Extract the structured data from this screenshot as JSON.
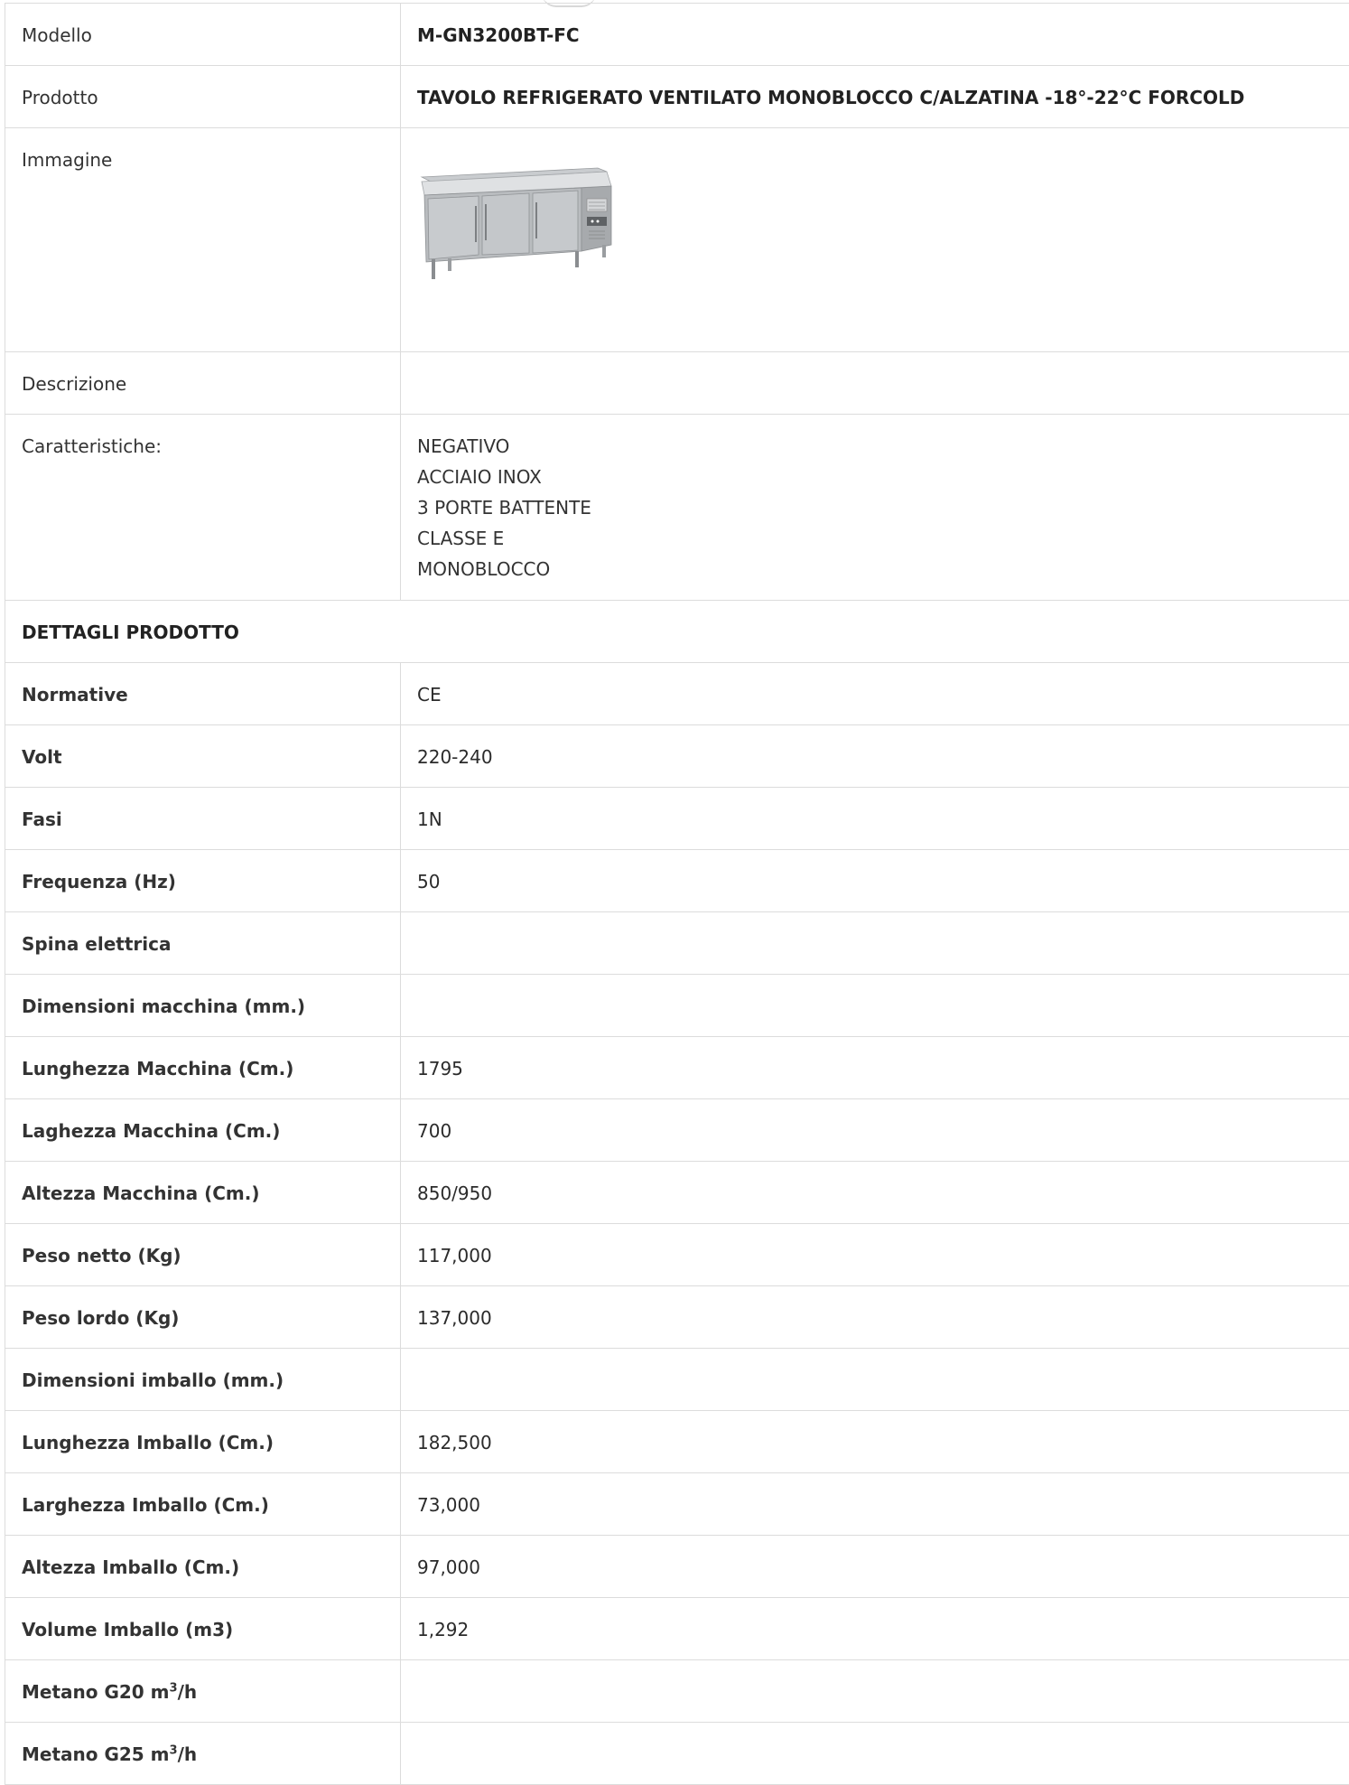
{
  "header_rows": [
    {
      "label": "Modello",
      "value": "M-GN3200BT-FC"
    },
    {
      "label": "Prodotto",
      "value": "TAVOLO REFRIGERATO VENTILATO MONOBLOCCO C/ALZATINA -18°-22°C FORCOLD"
    }
  ],
  "image_row": {
    "label": "Immagine",
    "image_icon": "refrigerated-table-image"
  },
  "description_row": {
    "label": "Descrizione",
    "value": ""
  },
  "features_row": {
    "label": "Caratteristiche:",
    "items": [
      "NEGATIVO",
      "ACCIAIO INOX",
      "3 PORTE BATTENTE",
      "CLASSE E",
      "MONOBLOCCO"
    ]
  },
  "section_title": "DETTAGLI PRODOTTO",
  "details": [
    {
      "label": "Normative",
      "value": "CE"
    },
    {
      "label": "Volt",
      "value": "220-240"
    },
    {
      "label": "Fasi",
      "value": "1N"
    },
    {
      "label": "Frequenza (Hz)",
      "value": "50"
    },
    {
      "label": "Spina elettrica",
      "value": ""
    },
    {
      "label": "Dimensioni macchina (mm.)",
      "value": ""
    },
    {
      "label": "Lunghezza Macchina (Cm.)",
      "value": "1795"
    },
    {
      "label": "Laghezza Macchina (Cm.)",
      "value": "700"
    },
    {
      "label": "Altezza Macchina (Cm.)",
      "value": "850/950"
    },
    {
      "label": "Peso netto (Kg)",
      "value": "117,000"
    },
    {
      "label": "Peso lordo (Kg)",
      "value": "137,000"
    },
    {
      "label": "Dimensioni imballo (mm.)",
      "value": ""
    },
    {
      "label": "Lunghezza Imballo (Cm.)",
      "value": "182,500"
    },
    {
      "label": "Larghezza Imballo (Cm.)",
      "value": "73,000"
    },
    {
      "label": "Altezza Imballo (Cm.)",
      "value": "97,000"
    },
    {
      "label": "Volume Imballo (m3)",
      "value": "1,292"
    }
  ],
  "gas_rows": [
    {
      "label_prefix": "Metano G20 m",
      "label_sup": "3",
      "label_suffix": "/h",
      "value": ""
    },
    {
      "label_prefix": "Metano G25 m",
      "label_sup": "3",
      "label_suffix": "/h",
      "value": ""
    }
  ]
}
